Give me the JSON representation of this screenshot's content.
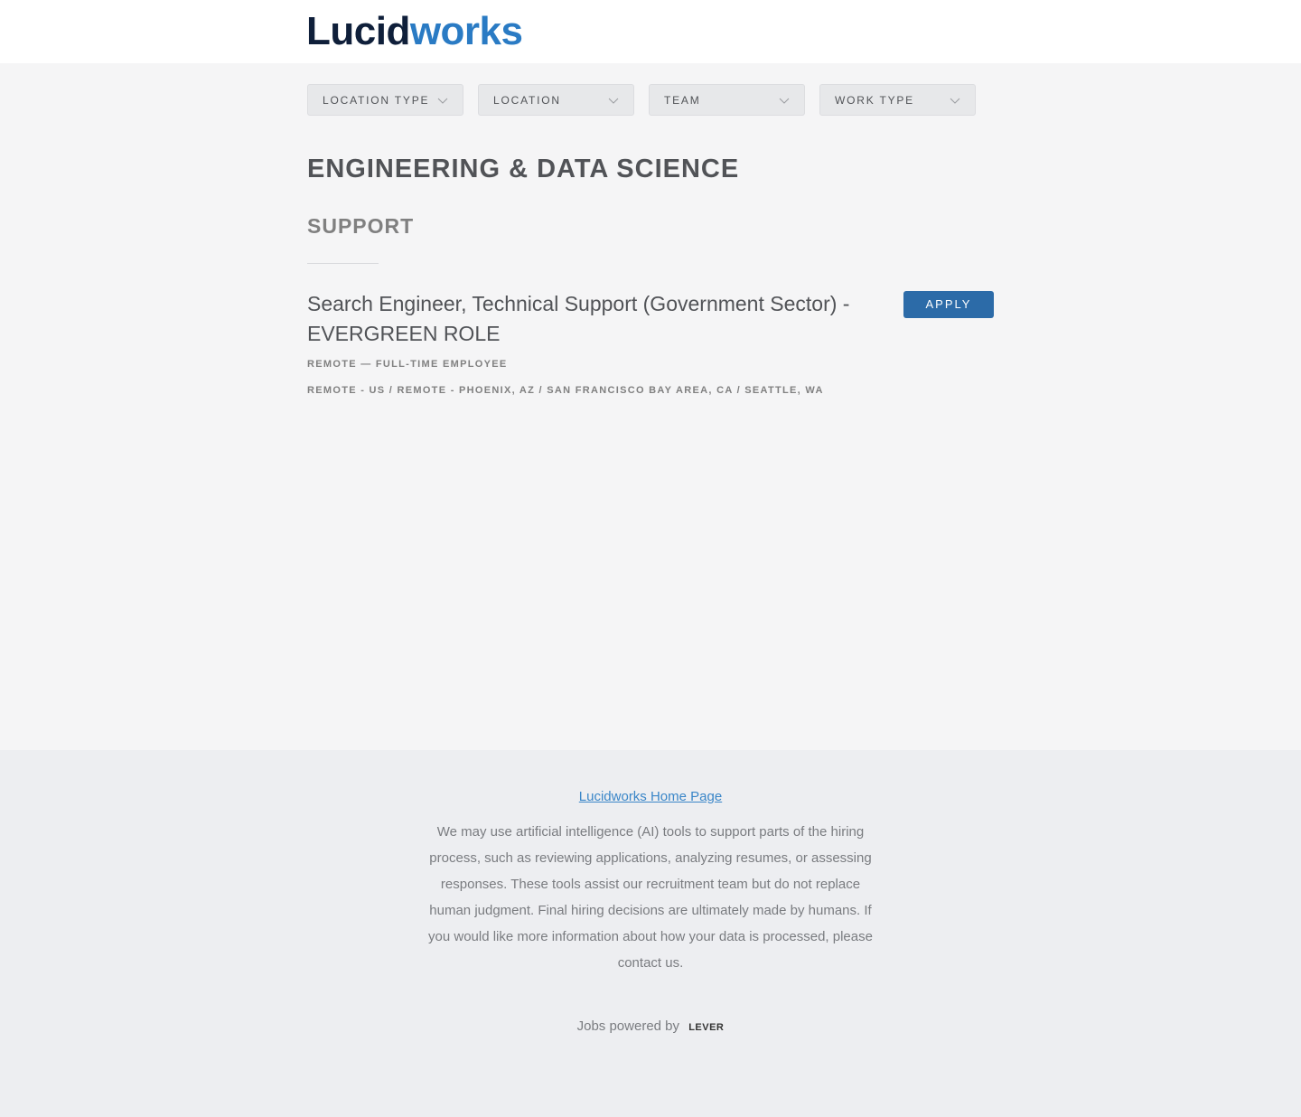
{
  "header": {
    "logo_part1": "Lucid",
    "logo_part2": "works"
  },
  "filters": [
    {
      "label": "LOCATION TYPE"
    },
    {
      "label": "LOCATION"
    },
    {
      "label": "TEAM"
    },
    {
      "label": "WORK TYPE"
    }
  ],
  "listing": {
    "group_title": "ENGINEERING & DATA SCIENCE",
    "sub_title": "SUPPORT",
    "posting": {
      "title": "Search Engineer, Technical Support (Government Sector) - EVERGREEN ROLE",
      "apply_label": "APPLY",
      "commitment": "REMOTE — FULL-TIME EMPLOYEE",
      "locations": "REMOTE - US / REMOTE - PHOENIX, AZ / SAN FRANCISCO BAY AREA, CA / SEATTLE, WA"
    }
  },
  "footer": {
    "home_link": "Lucidworks Home Page",
    "disclaimer": "We may use artificial intelligence (AI) tools to support parts of the hiring process, such as reviewing applications, analyzing resumes, or assessing responses. These tools assist our recruitment team but do not replace human judgment. Final hiring decisions are ultimately made by humans. If you would like more information about how your data is processed, please contact us.",
    "powered_by": "Jobs powered by",
    "powered_brand": "LEVER"
  }
}
